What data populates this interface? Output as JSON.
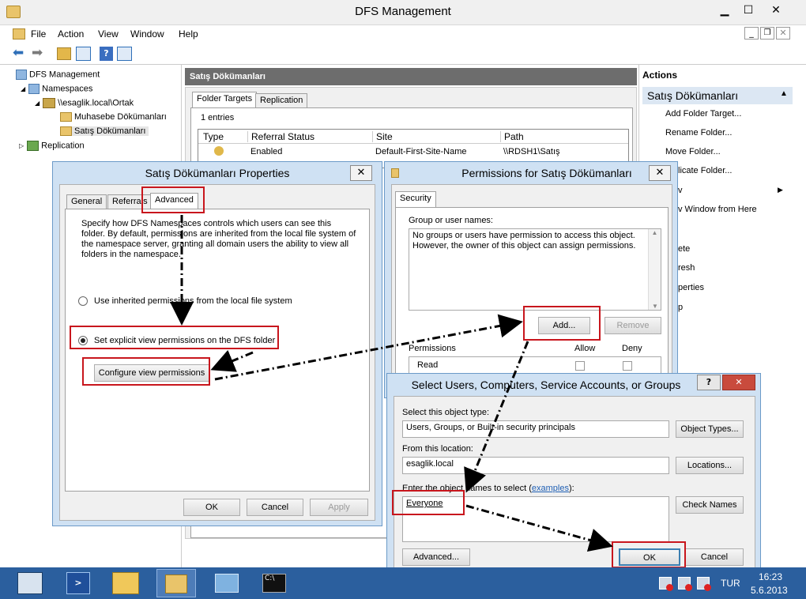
{
  "window": {
    "title": "DFS Management"
  },
  "menu": [
    "File",
    "Action",
    "View",
    "Window",
    "Help"
  ],
  "tree": {
    "root": "DFS Management",
    "namespaces": "Namespaces",
    "namespace": "\\\\esaglik.local\\Ortak",
    "folder1": "Muhasebe Dökümanları",
    "folder2": "Satış Dökümanları",
    "replication": "Replication"
  },
  "center": {
    "header": "Satış Dökümanları",
    "tab1": "Folder Targets",
    "tab2": "Replication",
    "entries": "1 entries",
    "columns": [
      "Type",
      "Referral Status",
      "Site",
      "Path"
    ],
    "row": {
      "status": "Enabled",
      "site": "Default-First-Site-Name",
      "path": "\\\\RDSH1\\Satış"
    }
  },
  "actions": {
    "header": "Actions",
    "section": "Satış Dökümanları",
    "items": [
      "Add Folder Target...",
      "Rename Folder...",
      "Move Folder...",
      "licate Folder...",
      "v",
      "v Window from Here",
      "ete",
      "resh",
      "perties",
      "p"
    ]
  },
  "props": {
    "title": "Satış Dökümanları Properties",
    "tabs": [
      "General",
      "Referrals",
      "Advanced"
    ],
    "description": "Specify how DFS Namespaces controls which users can see this folder. By default, permissions are inherited from the local file system of the namespace server, granting all domain users the ability to view all folders in the namespace.",
    "radio1": "Use inherited permissions from the local file system",
    "radio2": "Set explicit view permissions on the DFS folder",
    "configure": "Configure view permissions",
    "ok": "OK",
    "cancel": "Cancel",
    "apply": "Apply"
  },
  "perm": {
    "title": "Permissions for Satış Dökümanları",
    "tab": "Security",
    "group_label": "Group or user names:",
    "message": "No groups or users have permission to access this object. However, the owner of this object can assign permissions.",
    "add": "Add...",
    "remove": "Remove",
    "permissions": "Permissions",
    "allow": "Allow",
    "deny": "Deny",
    "read": "Read"
  },
  "select": {
    "title": "Select Users, Computers, Service Accounts, or Groups",
    "type_label": "Select this object type:",
    "type_value": "Users, Groups, or Built-in security principals",
    "object_types": "Object Types...",
    "location_label": "From this location:",
    "location_value": "esaglik.local",
    "locations": "Locations...",
    "names_label": "Enter the object names to select (",
    "examples": "examples",
    "names_label_end": "):",
    "names_value": "Everyone",
    "check_names": "Check Names",
    "advanced": "Advanced...",
    "ok": "OK",
    "cancel": "Cancel",
    "help": "?"
  },
  "taskbar": {
    "lang": "TUR",
    "time": "16:23",
    "date": "5.6.2013"
  },
  "colors": {
    "title_bar": "#f0f0f0",
    "dialog_frame": "#cfe1f3",
    "taskbar": "#2b5f9e",
    "highlight": "#c8161d",
    "section_header": "#dce7f3"
  }
}
